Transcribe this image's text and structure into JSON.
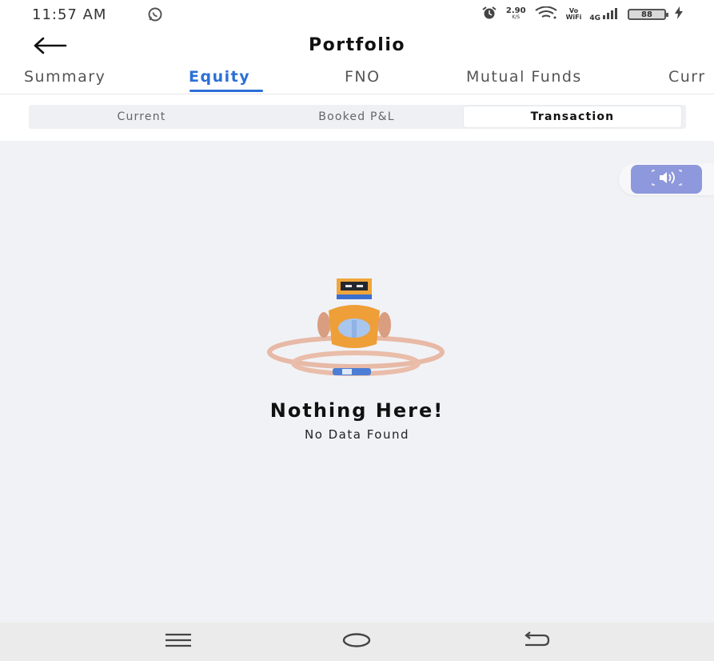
{
  "status_bar": {
    "time": "11:57 AM",
    "net_speed": "2.90",
    "net_speed_unit": "K/S",
    "volte_top": "Vo",
    "volte_bottom": "WiFi",
    "network": "4G",
    "battery": "88",
    "icons": [
      "whatsapp-icon",
      "alarm-icon",
      "wifi-icon",
      "signal-icon",
      "battery-icon",
      "charging-icon"
    ]
  },
  "header": {
    "title": "Portfolio",
    "back_icon": "arrow-left-icon"
  },
  "main_tabs": [
    {
      "label": "Summary",
      "active": false
    },
    {
      "label": "Equity",
      "active": true
    },
    {
      "label": "FNO",
      "active": false
    },
    {
      "label": "Mutual Funds",
      "active": false
    },
    {
      "label": "Curr",
      "active": false
    }
  ],
  "sub_tabs": [
    {
      "label": "Current",
      "active": false
    },
    {
      "label": "Booked P&L",
      "active": false
    },
    {
      "label": "Transaction",
      "active": true
    }
  ],
  "floating_button": {
    "icon": "speaker-icon"
  },
  "empty_state": {
    "title": "Nothing Here!",
    "subtitle": "No Data Found",
    "image": "robot-illustration"
  },
  "nav_bar": {
    "icons": [
      "menu-icon",
      "home-icon",
      "back-icon"
    ]
  },
  "colors": {
    "accent": "#2b6fd6",
    "content_bg": "#f1f2f6",
    "floating_button": "#8e98dc"
  }
}
